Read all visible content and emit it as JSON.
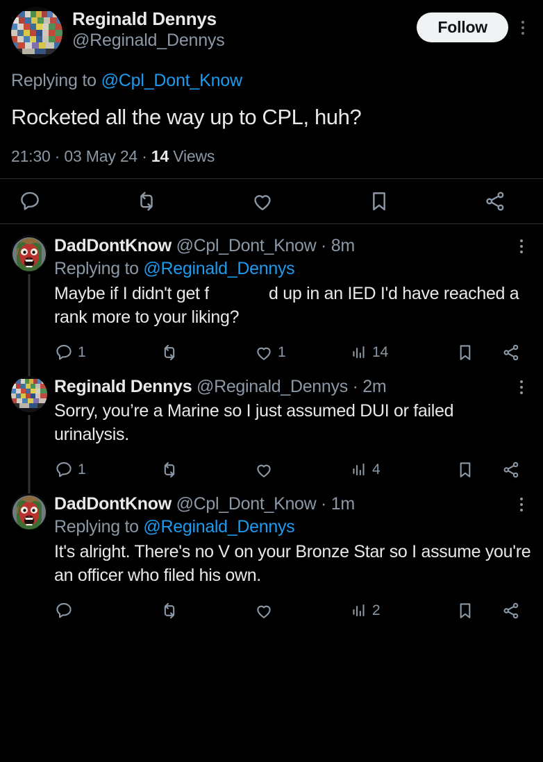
{
  "theme": {
    "background": "#000000",
    "text_primary": "#e7e9ea",
    "text_secondary": "#8b98a5",
    "link_blue": "#1d9bf0",
    "divider": "#2f3336",
    "follow_button_bg": "#eff3f4",
    "follow_button_text": "#0f1419"
  },
  "main_tweet": {
    "author": {
      "display_name": "Reginald Dennys",
      "handle": "@Reginald_Dennys",
      "avatar_name": "avatar-reginald-dennys"
    },
    "follow_label": "Follow",
    "replying_to_prefix": "Replying to ",
    "replying_to_handle": "@Cpl_Dont_Know",
    "body": "Rocketed all the way up to CPL, huh?",
    "meta": {
      "time": "21:30",
      "dot1": " · ",
      "date": "03 May 24",
      "dot2": " · ",
      "views_count": "14",
      "views_label": " Views"
    },
    "actions": [
      {
        "icon": "reply-icon",
        "name": "reply-button",
        "count": ""
      },
      {
        "icon": "retweet-icon",
        "name": "retweet-button",
        "count": ""
      },
      {
        "icon": "like-icon",
        "name": "like-button",
        "count": ""
      },
      {
        "icon": "bookmark-icon",
        "name": "bookmark-button",
        "count": ""
      },
      {
        "icon": "share-icon",
        "name": "share-button",
        "count": ""
      }
    ]
  },
  "replies": [
    {
      "display_name": "DadDontKnow",
      "handle": "@Cpl_Dont_Know",
      "separator": " · ",
      "timestamp": "8m",
      "avatar_name": "avatar-daddontknow",
      "avatar_kind": "red-face",
      "has_replying_to": true,
      "replying_to_prefix": "Replying to ",
      "replying_to_handle": "@Reginald_Dennys",
      "body_before": "Maybe if I didn't get f",
      "body_redacted": true,
      "body_after": "d up in an IED I'd have reached a rank more to your liking?",
      "actions": {
        "reply_count": "1",
        "retweet_count": "",
        "like_count": "1",
        "views_count": "14",
        "bookmark_count": "",
        "share_count": ""
      }
    },
    {
      "display_name": "Reginald Dennys",
      "handle": "@Reginald_Dennys",
      "separator": " · ",
      "timestamp": "2m",
      "avatar_name": "avatar-reginald-dennys",
      "avatar_kind": "containers",
      "has_replying_to": false,
      "replying_to_prefix": "",
      "replying_to_handle": "",
      "body_before": "Sorry, you’re a Marine so I just assumed DUI or failed urinalysis.",
      "body_redacted": false,
      "body_after": "",
      "actions": {
        "reply_count": "1",
        "retweet_count": "",
        "like_count": "",
        "views_count": "4",
        "bookmark_count": "",
        "share_count": ""
      }
    },
    {
      "display_name": "DadDontKnow",
      "handle": "@Cpl_Dont_Know",
      "separator": " · ",
      "timestamp": "1m",
      "avatar_name": "avatar-daddontknow",
      "avatar_kind": "red-face",
      "has_replying_to": true,
      "replying_to_prefix": "Replying to ",
      "replying_to_handle": "@Reginald_Dennys",
      "body_before": "It's alright. There's no V on your Bronze Star so I assume you're an officer who filed his own.",
      "body_redacted": false,
      "body_after": "",
      "actions": {
        "reply_count": "",
        "retweet_count": "",
        "like_count": "",
        "views_count": "2",
        "bookmark_count": "",
        "share_count": ""
      }
    }
  ]
}
